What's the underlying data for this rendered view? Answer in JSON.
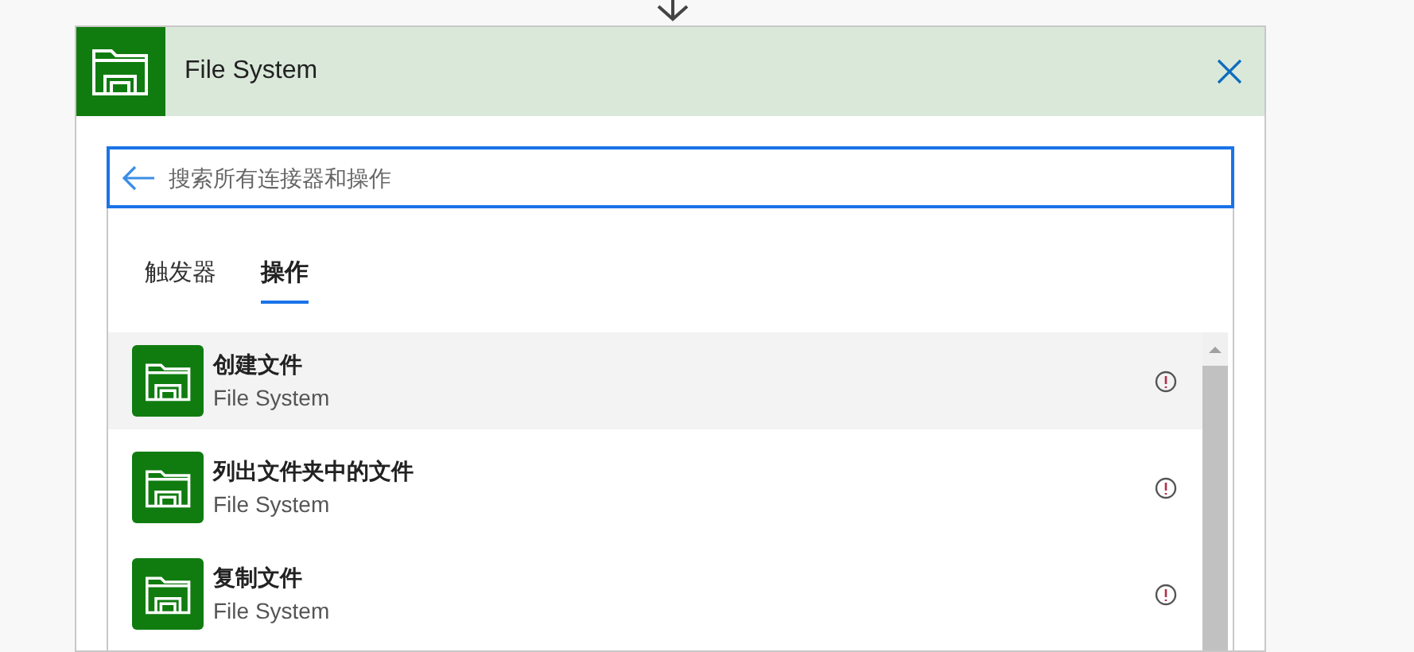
{
  "connector": {
    "title": "File System"
  },
  "search": {
    "placeholder": "搜索所有连接器和操作"
  },
  "tabs": [
    {
      "label": "触发器",
      "selected": false
    },
    {
      "label": "操作",
      "selected": true
    }
  ],
  "actions": [
    {
      "name": "创建文件",
      "connector": "File System",
      "selected": true
    },
    {
      "name": "列出文件夹中的文件",
      "connector": "File System",
      "selected": false
    },
    {
      "name": "复制文件",
      "connector": "File System",
      "selected": false
    }
  ]
}
